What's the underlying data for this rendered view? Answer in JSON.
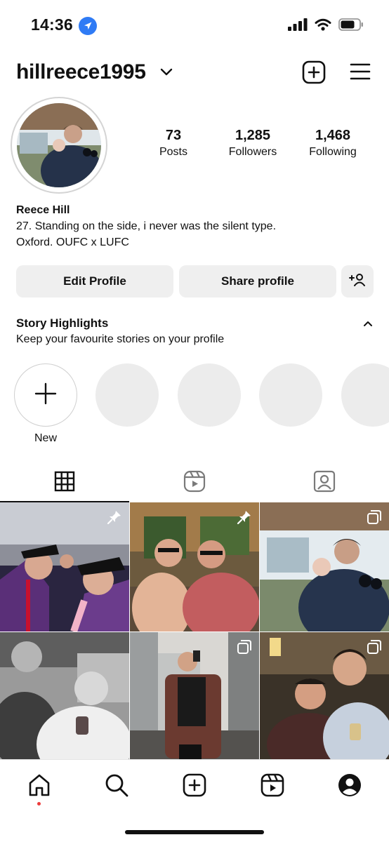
{
  "status": {
    "time": "14:36",
    "icons": [
      "location-icon",
      "signal-icon",
      "wifi-icon",
      "battery-icon"
    ]
  },
  "header": {
    "username": "hillreece1995",
    "icons": [
      "chevron-down-icon",
      "create-post-icon",
      "menu-icon"
    ]
  },
  "stats": [
    {
      "value": "73",
      "label": "Posts"
    },
    {
      "value": "1,285",
      "label": "Followers"
    },
    {
      "value": "1,468",
      "label": "Following"
    }
  ],
  "bio": {
    "name": "Reece Hill",
    "line1": "27. Standing on the side, i never was the silent type.",
    "line2": "Oxford. OUFC x LUFC"
  },
  "buttons": {
    "edit": "Edit Profile",
    "share": "Share profile"
  },
  "highlights": {
    "title": "Story Highlights",
    "subtitle": "Keep your favourite stories on your profile",
    "new_label": "New"
  },
  "tabs": [
    "grid-icon",
    "reels-icon",
    "tagged-icon"
  ],
  "colors": {
    "accent": "#2f7bf5",
    "button_bg": "#efefef",
    "notification_dot": "#ed3b3b"
  },
  "nav": [
    "home-icon",
    "search-icon",
    "create-icon",
    "reels-icon",
    "profile-icon"
  ]
}
